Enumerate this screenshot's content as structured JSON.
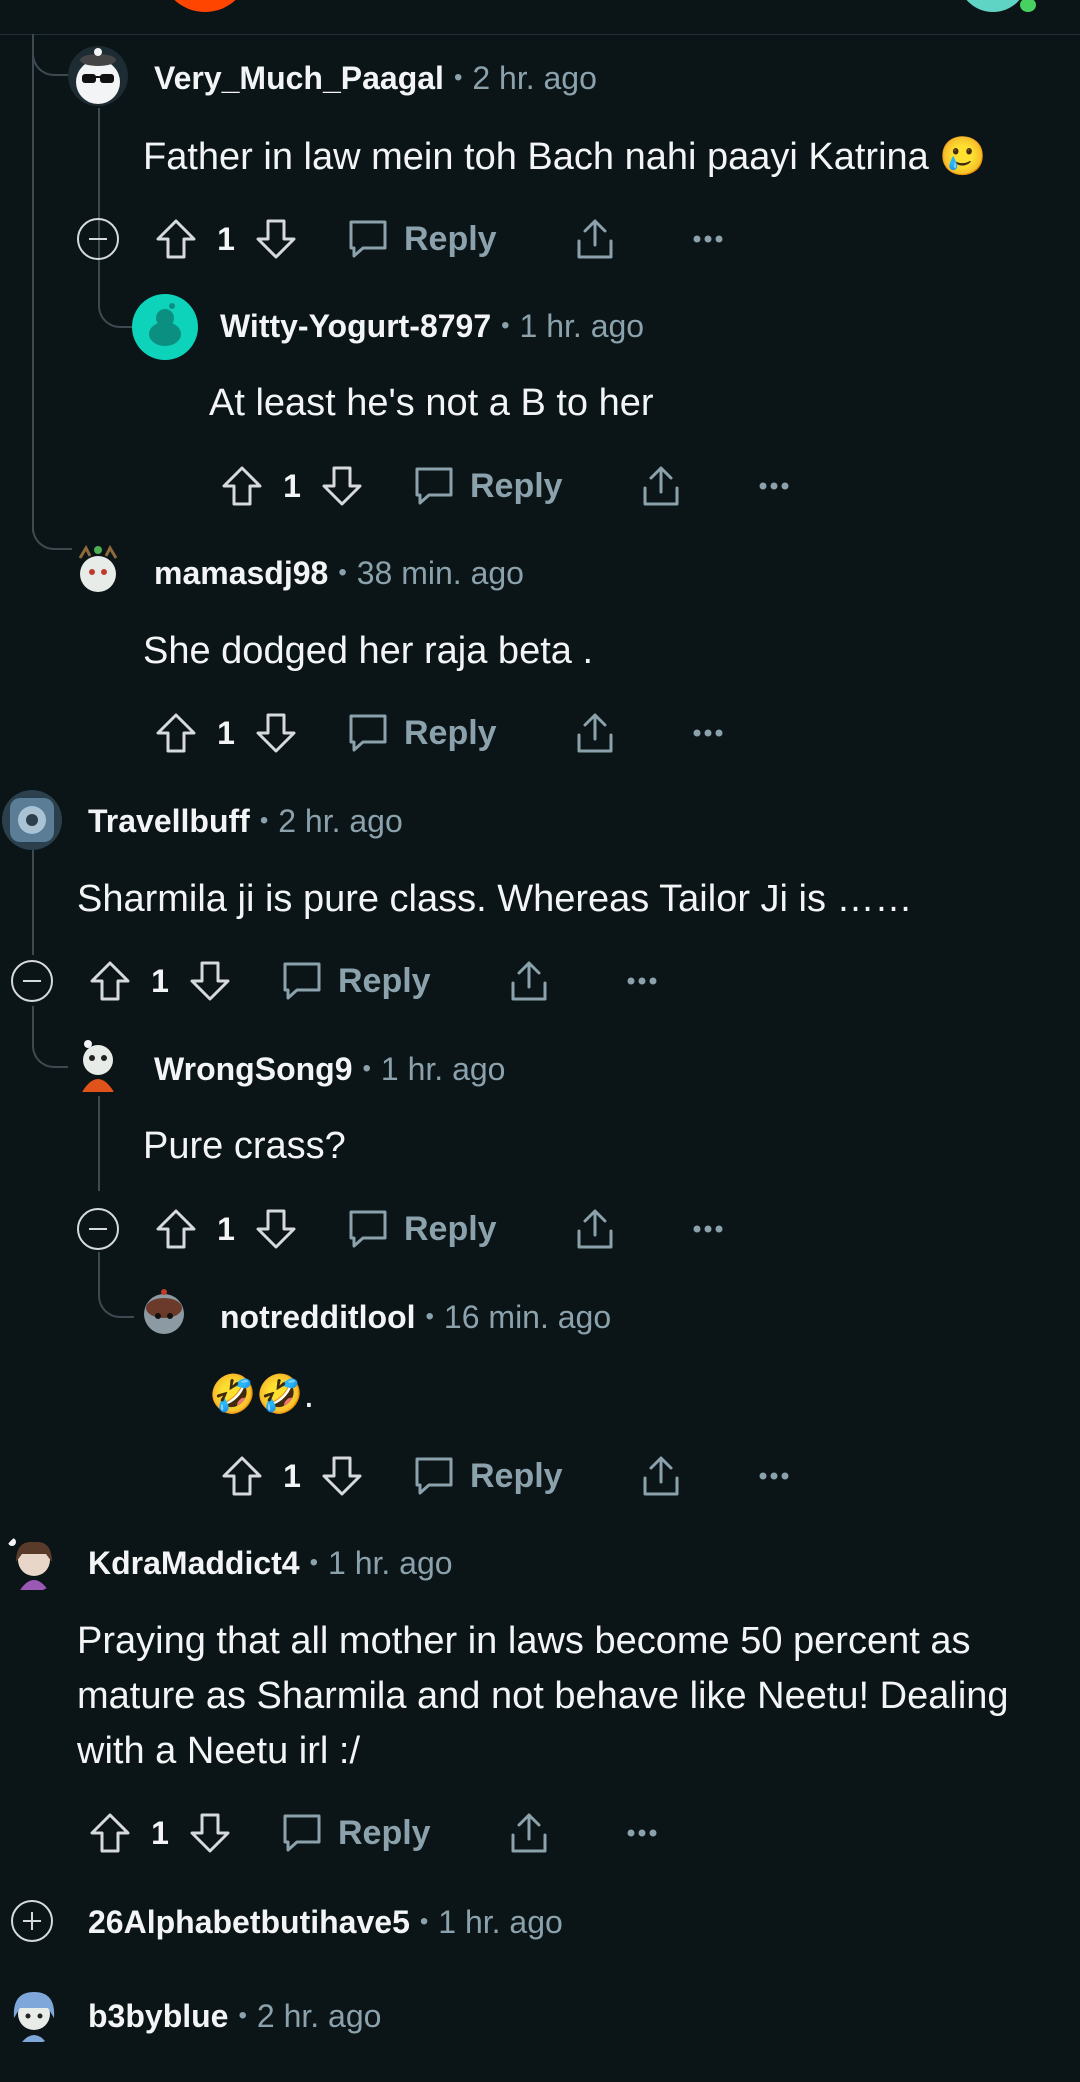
{
  "colors": {
    "background": "#0b1416",
    "text": "#f2f4f5",
    "muted": "#8ba2ad",
    "thread_line": "#3e4a52",
    "online": "#46d160"
  },
  "comments": [
    {
      "username": "Very_Much_Paagal",
      "time": "2 hr. ago",
      "body": "Father in law mein toh Bach nahi paayi Katrina 🥲",
      "votes": "1",
      "reply_label": "Reply"
    },
    {
      "username": "Witty-Yogurt-8797",
      "time": "1 hr. ago",
      "body": "At least he's not a B to her",
      "votes": "1",
      "reply_label": "Reply"
    },
    {
      "username": "mamasdj98",
      "time": "38 min. ago",
      "body": "She dodged her raja beta .",
      "votes": "1",
      "reply_label": "Reply"
    },
    {
      "username": "Travellbuff",
      "time": "2 hr. ago",
      "body": "Sharmila ji is pure class. Whereas Tailor Ji is ……",
      "votes": "1",
      "reply_label": "Reply"
    },
    {
      "username": "WrongSong9",
      "time": "1 hr. ago",
      "body": "Pure crass?",
      "votes": "1",
      "reply_label": "Reply"
    },
    {
      "username": "notredditlool",
      "time": "16 min. ago",
      "body": "🤣🤣.",
      "votes": "1",
      "reply_label": "Reply"
    },
    {
      "username": "KdraMaddict4",
      "time": "1 hr. ago",
      "body_lines": [
        "Praying that all mother in laws become 50 percent as",
        "mature as Sharmila and not behave like Neetu! Dealing",
        "with a Neetu irl :/"
      ],
      "votes": "1",
      "reply_label": "Reply"
    },
    {
      "username": "26Alphabetbutihave5",
      "time": "1 hr. ago"
    },
    {
      "username": "b3byblue",
      "time": "2 hr. ago"
    }
  ],
  "icons": {
    "upvote": "arrow-up-icon",
    "downvote": "arrow-down-icon",
    "reply": "speech-bubble-icon",
    "share": "share-icon",
    "more": "ellipsis-icon",
    "collapse": "minus-circle-icon",
    "expand": "plus-circle-icon"
  }
}
